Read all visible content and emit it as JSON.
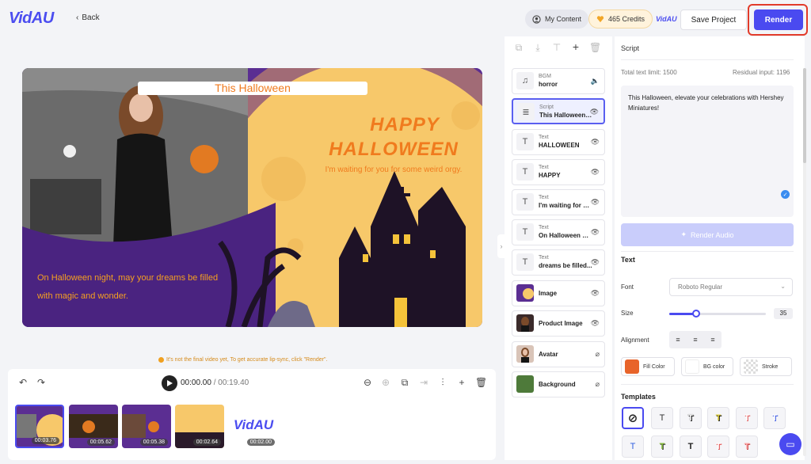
{
  "header": {
    "logo": "VidAU",
    "back_label": "Back",
    "my_content_label": "My Content",
    "credits_label": "465 Credits",
    "brand_small": "VidAU",
    "save_label": "Save Project",
    "render_label": "Render",
    "icons": {
      "back": "chevron-left-icon",
      "content": "user-circle-icon",
      "credits": "heart-gem-icon"
    }
  },
  "canvas": {
    "title_text": "This Halloween",
    "happy": "HAPPY",
    "halloween": "HALLOWEEN",
    "waiting": "I'm waiting for you for some weird orgy.",
    "bottom_text": "On Halloween night, may your dreams be filled with magic and wonder.",
    "colors": {
      "accent_text": "#f07b1e",
      "background_purple": "#5b2e92",
      "moon": "#f7c86a"
    }
  },
  "notice": "It's not the final video yet, To get accurate lip-sync, click \"Render\".",
  "timeline": {
    "current_time": "00:00.00",
    "total_time": "/ 00:19.40",
    "clips": [
      {
        "duration": "00:03.76"
      },
      {
        "duration": "00:05.62"
      },
      {
        "duration": "00:05.38"
      },
      {
        "duration": "00:02.64"
      },
      {
        "duration": "00:02.00",
        "label": "VidAU"
      }
    ]
  },
  "layers": [
    {
      "sub": "BGM",
      "name": "horror",
      "icon": "music-icon",
      "trailing": "volume-icon"
    },
    {
      "sub": "Script",
      "name": "This Halloween, e...",
      "icon": "script-icon",
      "trailing": "eye-icon",
      "selected": true
    },
    {
      "sub": "Text",
      "name": "HALLOWEEN",
      "icon": "T",
      "trailing": "eye-icon"
    },
    {
      "sub": "Text",
      "name": "HAPPY",
      "icon": "T",
      "trailing": "eye-icon"
    },
    {
      "sub": "Text",
      "name": "I'm waiting for you...",
      "icon": "T",
      "trailing": "eye-icon"
    },
    {
      "sub": "Text",
      "name": "On Halloween night...",
      "icon": "T",
      "trailing": "eye-icon"
    },
    {
      "sub": "Text",
      "name": "dreams be filled...",
      "icon": "T",
      "trailing": "eye-icon"
    },
    {
      "sub": "",
      "name": "Image",
      "icon": "image",
      "trailing": "eye-icon"
    },
    {
      "sub": "",
      "name": "Product Image",
      "icon": "image",
      "trailing": "eye-icon"
    },
    {
      "sub": "",
      "name": "Avatar",
      "icon": "avatar",
      "trailing": "eye-off-icon"
    },
    {
      "sub": "",
      "name": "Background",
      "icon": "bg",
      "trailing": "eye-off-icon"
    }
  ],
  "script_panel": {
    "title": "Script",
    "total_limit": "Total text limit: 1500",
    "residual": "Residual input: 1196",
    "text": "This Halloween, elevate your celebrations with Hershey Miniatures!",
    "render_audio_label": "Render Audio"
  },
  "text_panel": {
    "title": "Text",
    "font_label": "Font",
    "font_value": "Roboto Regular",
    "size_label": "Size",
    "size_value": "35",
    "size_fraction": 0.28,
    "alignment_label": "Alignment",
    "fill_color_label": "Fill Color",
    "bg_color_label": "BG color",
    "stroke_label": "Stroke",
    "fill_color": "#e8642a",
    "templates_title": "Templates"
  }
}
